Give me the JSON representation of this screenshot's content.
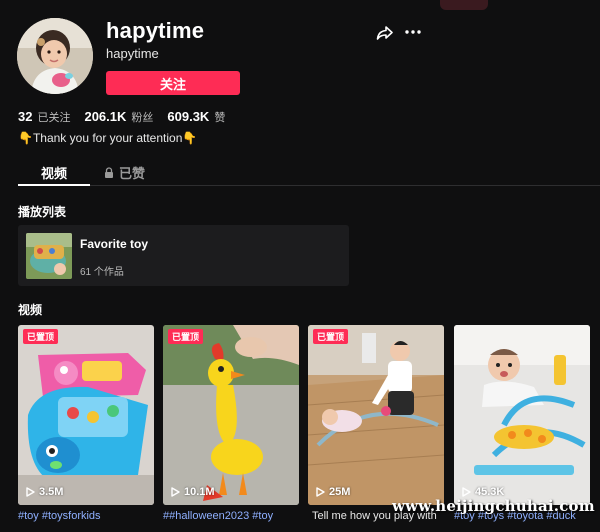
{
  "profile": {
    "username": "hapytime",
    "nickname": "hapytime",
    "follow_label": "关注",
    "bio": "Thank you for your attention"
  },
  "stats": {
    "following": {
      "value": "32",
      "label": "已关注"
    },
    "followers": {
      "value": "206.1K",
      "label": "粉丝"
    },
    "likes": {
      "value": "609.3K",
      "label": "赞"
    }
  },
  "tabs": {
    "videos": "视频",
    "liked": "已赞"
  },
  "playlists": {
    "heading": "播放列表",
    "items": [
      {
        "title": "Favorite toy",
        "count": "61 个作品"
      }
    ]
  },
  "videos": {
    "heading": "视频",
    "items": [
      {
        "pinned": "已置顶",
        "views": "3.5M",
        "caption": "#toy #toysforkids"
      },
      {
        "pinned": "已置顶",
        "views": "10.1M",
        "caption": "##halloween2023 #toy"
      },
      {
        "pinned": "已置顶",
        "views": "25M",
        "caption": "Tell me how you play with"
      },
      {
        "pinned": "",
        "views": "45.3K",
        "caption": "#toy #toys #toyota #duck"
      }
    ]
  },
  "watermark": "www.heijingchuhai.com",
  "colors": {
    "background": "#0f0f10",
    "accent": "#fe2c55",
    "hashtag": "#8fb0ff"
  },
  "icons": [
    "share-icon",
    "more-icon",
    "lock-icon",
    "play-icon",
    "hand-pointing-down-icon"
  ]
}
